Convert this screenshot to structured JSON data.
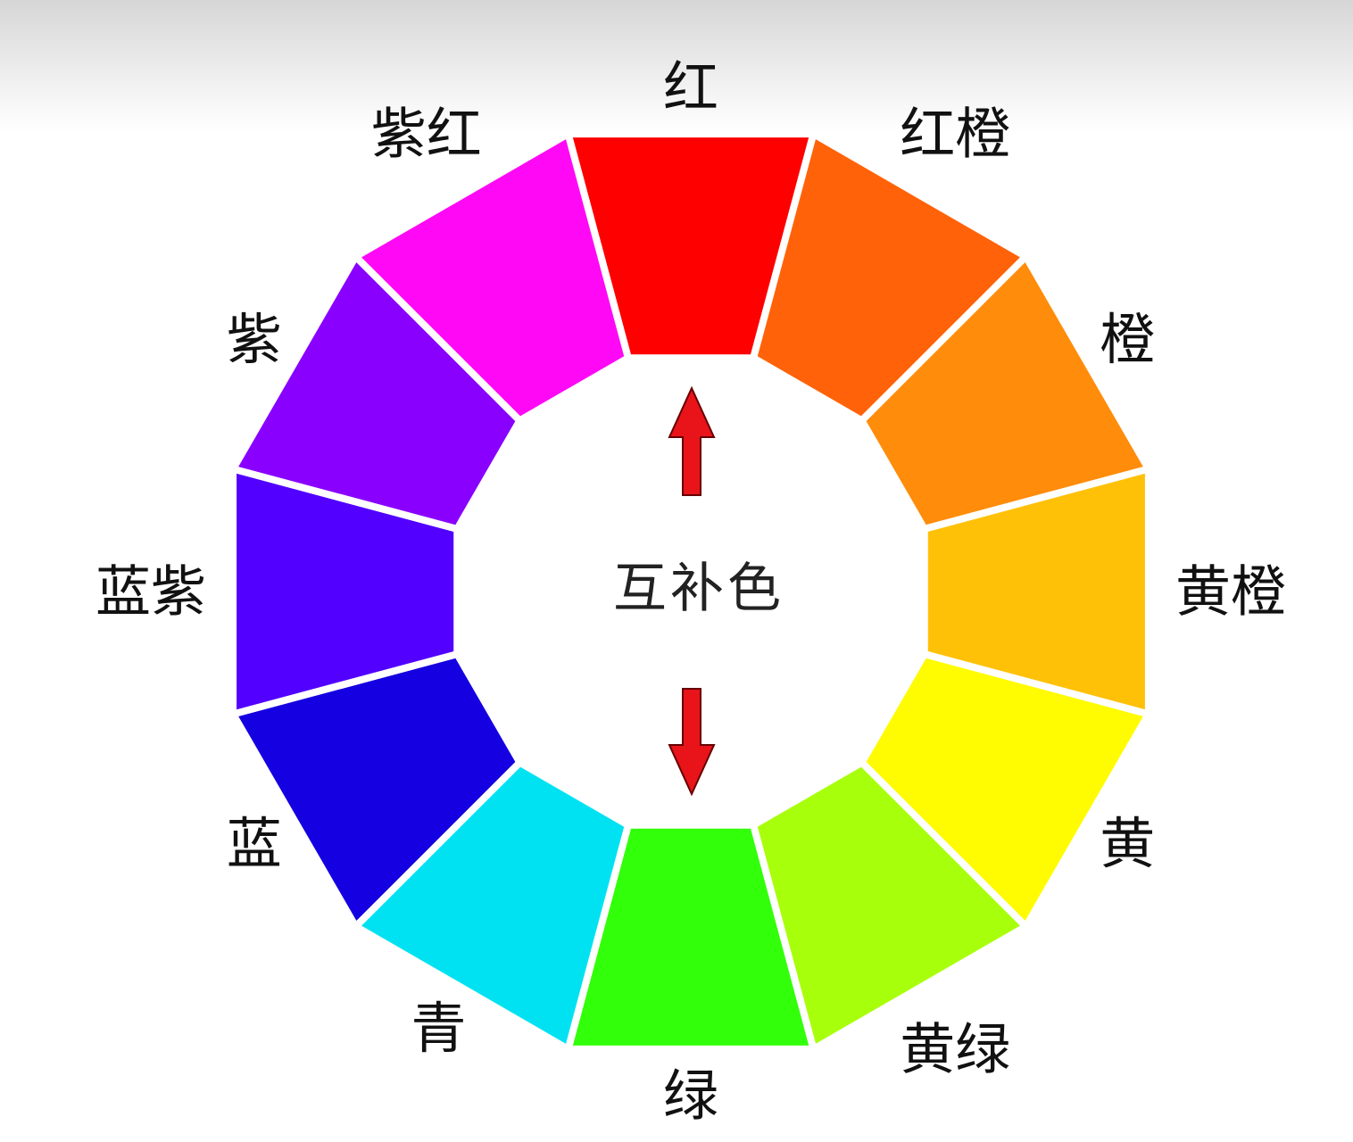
{
  "title": "互补色",
  "segments": [
    {
      "label": "红",
      "color": "#ff0000"
    },
    {
      "label": "红橙",
      "color": "#ff6208"
    },
    {
      "label": "橙",
      "color": "#ff8c0a"
    },
    {
      "label": "黄橙",
      "color": "#ffc108"
    },
    {
      "label": "黄",
      "color": "#fffb00"
    },
    {
      "label": "黄绿",
      "color": "#a8ff0c"
    },
    {
      "label": "绿",
      "color": "#32ff0a"
    },
    {
      "label": "青",
      "color": "#00e2f2"
    },
    {
      "label": "蓝",
      "color": "#1400e0"
    },
    {
      "label": "蓝紫",
      "color": "#5200ff"
    },
    {
      "label": "紫",
      "color": "#8a00ff"
    },
    {
      "label": "紫红",
      "color": "#ff08f6"
    }
  ],
  "arrow_color": "#e8141a"
}
